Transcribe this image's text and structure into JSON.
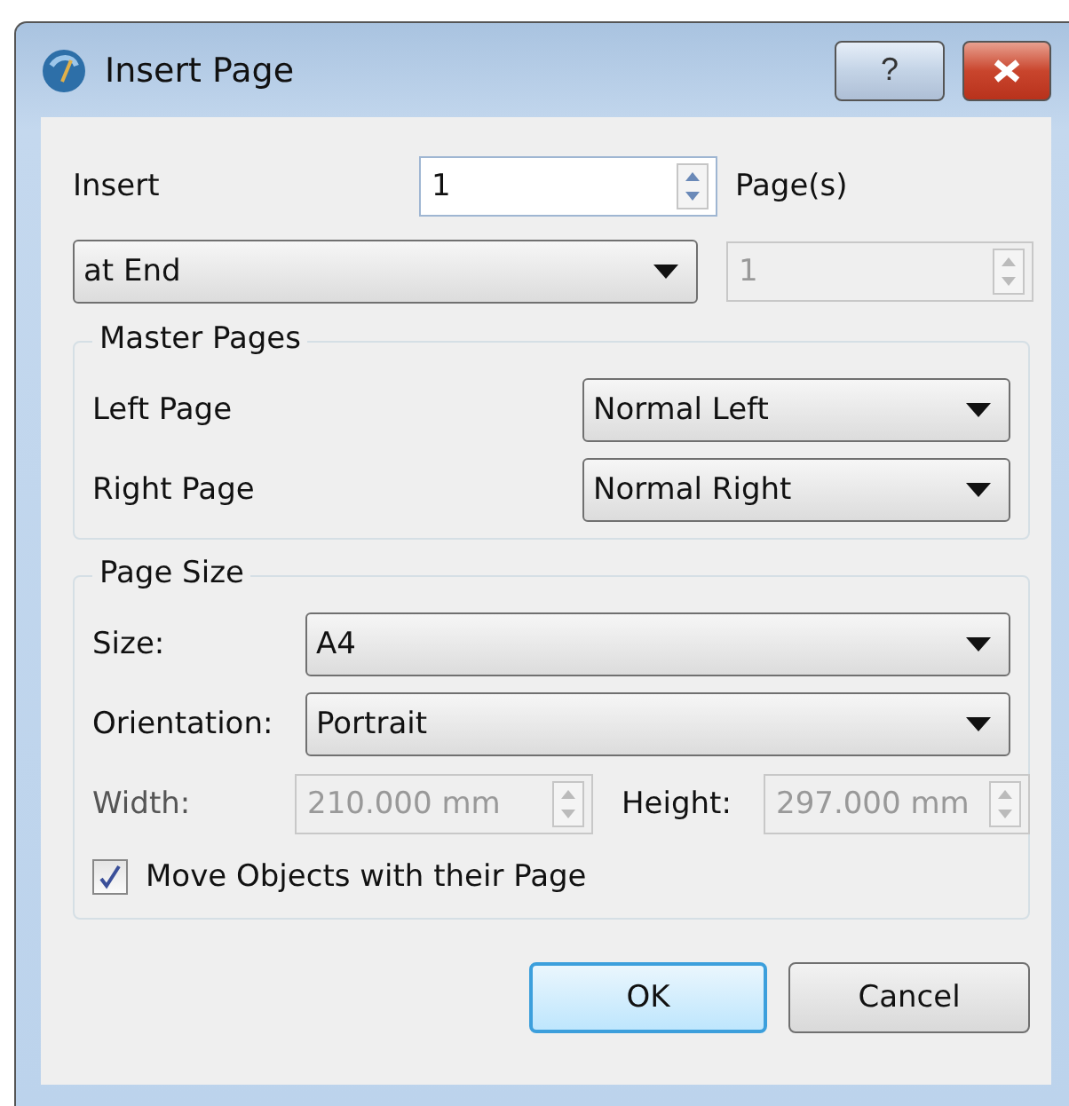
{
  "window": {
    "title": "Insert Page",
    "help_button": "?"
  },
  "insert": {
    "label": "Insert",
    "value": "1",
    "suffix": "Page(s)",
    "position": "at End",
    "position_page": "1",
    "position_page_disabled": true
  },
  "master_pages": {
    "title": "Master Pages",
    "rows": [
      {
        "label": "Left Page",
        "value": "Normal Left"
      },
      {
        "label": "Right Page",
        "value": "Normal Right"
      }
    ]
  },
  "page_size": {
    "title": "Page Size",
    "size_label": "Size:",
    "size": "A4",
    "orientation_label": "Orientation:",
    "orientation": "Portrait",
    "width_label": "Width:",
    "width": "210.000 mm",
    "width_disabled": true,
    "height_label": "Height:",
    "height": "297.000 mm",
    "height_disabled": true,
    "move_objects": {
      "label": "Move Objects with their Page",
      "checked": true
    }
  },
  "buttons": [
    {
      "label": "OK",
      "default": true
    },
    {
      "label": "Cancel",
      "default": false
    }
  ]
}
